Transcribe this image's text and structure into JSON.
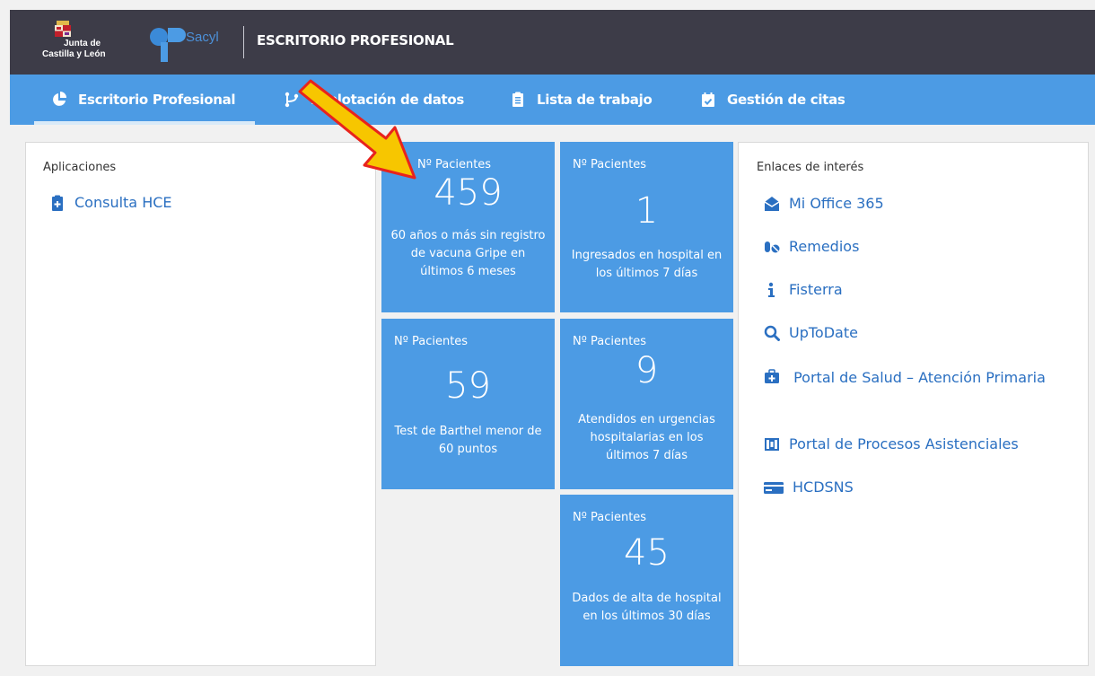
{
  "header": {
    "jcyl_line1": "Junta de",
    "jcyl_line2": "Castilla y León",
    "sacyl_text": "Sacyl",
    "title": "ESCRITORIO PROFESIONAL"
  },
  "nav": {
    "items": [
      {
        "label": "Escritorio Profesional",
        "icon": "pie-chart-icon"
      },
      {
        "label": "Explotación de datos",
        "icon": "branch-icon"
      },
      {
        "label": "Lista de trabajo",
        "icon": "clipboard-icon"
      },
      {
        "label": "Gestión de citas",
        "icon": "calendar-check-icon"
      }
    ]
  },
  "apps": {
    "title": "Aplicaciones",
    "items": [
      {
        "label": "Consulta HCE",
        "icon": "medical-clipboard-icon"
      }
    ]
  },
  "tiles": [
    {
      "label": "Nº Pacientes",
      "value": "459",
      "desc": "60 años o más sin registro de vacuna Gripe en últimos 6 meses"
    },
    {
      "label": "Nº Pacientes",
      "value": "1",
      "desc": "Ingresados en hospital en los últimos 7 días"
    },
    {
      "label": "Nº Pacientes",
      "value": "59",
      "desc": "Test de Barthel menor de 60 puntos"
    },
    {
      "label": "Nº Pacientes",
      "value": "9",
      "desc": "Atendidos en urgencias hospitalarias en los últimos 7 días"
    },
    {
      "label": "Nº Pacientes",
      "value": "45",
      "desc": "Dados de alta de hospital en los últimos 30 días"
    }
  ],
  "links": {
    "title": "Enlaces de interés",
    "items": [
      {
        "label": "Mi Office 365",
        "icon": "envelope-open-icon"
      },
      {
        "label": "Remedios",
        "icon": "pills-icon"
      },
      {
        "label": "Fisterra",
        "icon": "info-icon"
      },
      {
        "label": "UpToDate",
        "icon": "search-icon"
      },
      {
        "label": "Portal de Salud – Atención Primaria",
        "icon": "medkit-icon"
      },
      {
        "label": "Portal de Procesos Asistenciales",
        "icon": "process-icon"
      },
      {
        "label": "HCDSNS",
        "icon": "id-card-icon"
      }
    ]
  },
  "colors": {
    "topbar": "#3d3c48",
    "navbar": "#4c9be4",
    "tile": "#4c9be4",
    "link": "#2a6fc1",
    "arrow_fill": "#f7c600",
    "arrow_stroke": "#e8231c"
  }
}
